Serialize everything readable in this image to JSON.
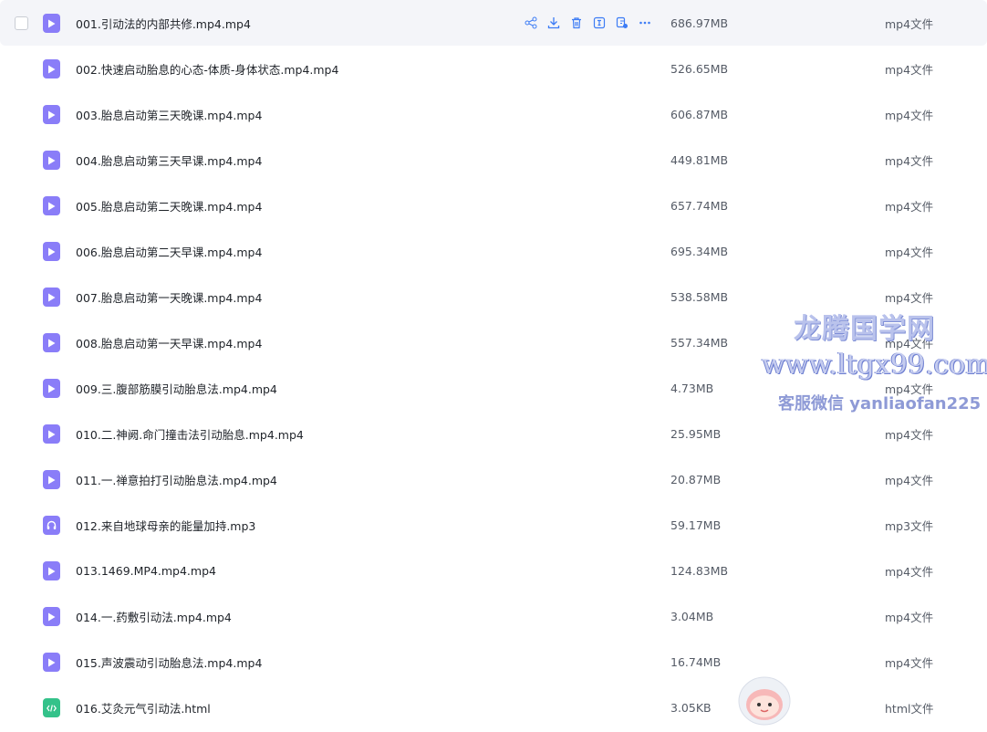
{
  "files": [
    {
      "name": "001.引动法的内部共修.mp4.mp4",
      "size": "686.97MB",
      "type": "mp4文件",
      "icon": "video-file-icon"
    },
    {
      "name": "002.快速启动胎息的心态-体质-身体状态.mp4.mp4",
      "size": "526.65MB",
      "type": "mp4文件",
      "icon": "video-file-icon"
    },
    {
      "name": "003.胎息启动第三天晚课.mp4.mp4",
      "size": "606.87MB",
      "type": "mp4文件",
      "icon": "video-file-icon"
    },
    {
      "name": "004.胎息启动第三天早课.mp4.mp4",
      "size": "449.81MB",
      "type": "mp4文件",
      "icon": "video-file-icon"
    },
    {
      "name": "005.胎息启动第二天晚课.mp4.mp4",
      "size": "657.74MB",
      "type": "mp4文件",
      "icon": "video-file-icon"
    },
    {
      "name": "006.胎息启动第二天早课.mp4.mp4",
      "size": "695.34MB",
      "type": "mp4文件",
      "icon": "video-file-icon"
    },
    {
      "name": "007.胎息启动第一天晚课.mp4.mp4",
      "size": "538.58MB",
      "type": "mp4文件",
      "icon": "video-file-icon"
    },
    {
      "name": "008.胎息启动第一天早课.mp4.mp4",
      "size": "557.34MB",
      "type": "mp4文件",
      "icon": "video-file-icon"
    },
    {
      "name": "009.三.腹部筋膜引动胎息法.mp4.mp4",
      "size": "4.73MB",
      "type": "mp4文件",
      "icon": "video-file-icon"
    },
    {
      "name": "010.二.神阙.命门撞击法引动胎息.mp4.mp4",
      "size": "25.95MB",
      "type": "mp4文件",
      "icon": "video-file-icon"
    },
    {
      "name": "011.一.禅意拍打引动胎息法.mp4.mp4",
      "size": "20.87MB",
      "type": "mp4文件",
      "icon": "video-file-icon"
    },
    {
      "name": "012.来自地球母亲的能量加持.mp3",
      "size": "59.17MB",
      "type": "mp3文件",
      "icon": "audio-file-icon"
    },
    {
      "name": "013.1469.MP4.mp4.mp4",
      "size": "124.83MB",
      "type": "mp4文件",
      "icon": "video-file-icon"
    },
    {
      "name": "014.一.药敷引动法.mp4.mp4",
      "size": "3.04MB",
      "type": "mp4文件",
      "icon": "video-file-icon"
    },
    {
      "name": "015.声波震动引动胎息法.mp4.mp4",
      "size": "16.74MB",
      "type": "mp4文件",
      "icon": "video-file-icon"
    },
    {
      "name": "016.艾灸元气引动法.html",
      "size": "3.05KB",
      "type": "html文件",
      "icon": "html-file-icon"
    }
  ],
  "row_actions": [
    "share-icon",
    "download-icon",
    "delete-icon",
    "rename-icon",
    "copy-icon",
    "more-icon"
  ],
  "watermark": {
    "line1": "龙腾国学网",
    "line2": "www.ltgx99.com",
    "line3": "客服微信 yanliaofan225"
  },
  "colors": {
    "accent": "#8a7df8",
    "action": "#3d7cf5",
    "html": "#34c28a"
  }
}
